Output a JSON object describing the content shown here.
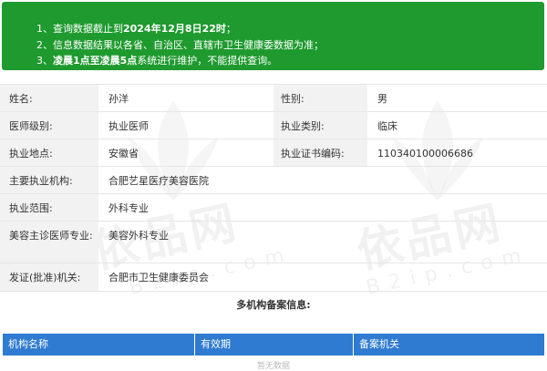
{
  "notice": {
    "line1_prefix": "1、查询数据截止到",
    "line1_bold": "2024年12月8日22时",
    "line1_suffix": "；",
    "line2": "2、信息数据结果以各省、自治区、直辖市卫生健康委数据为准；",
    "line3_prefix": "3、",
    "line3_bold": "凌晨1点至凌晨5点",
    "line3_suffix": "系统进行维护，不能提供查询。"
  },
  "watermark": {
    "text": "依品网",
    "sub": "B2ip.com"
  },
  "doctor": {
    "name_label": "姓名:",
    "name": "孙洋",
    "gender_label": "性别:",
    "gender": "男",
    "level_label": "医师级别:",
    "level": "执业医师",
    "category_label": "执业类别:",
    "category": "临床",
    "location_label": "执业地点:",
    "location": "安徽省",
    "cert_label": "执业证书编码:",
    "cert": "110340100006686",
    "institution_label": "主要执业机构:",
    "institution": "合肥艺星医疗美容医院",
    "scope_label": "执业范围:",
    "scope": "外科专业",
    "cosmetic_label": "美容主诊医师专业:",
    "cosmetic": "美容外科专业",
    "issuer_label": "发证(批准)机关:",
    "issuer": "合肥市卫生健康委员会"
  },
  "multi": {
    "title": "多机构备案信息:",
    "columns": [
      "机构名称",
      "有效期",
      "备案机关"
    ],
    "empty_text": "暂无数据"
  }
}
